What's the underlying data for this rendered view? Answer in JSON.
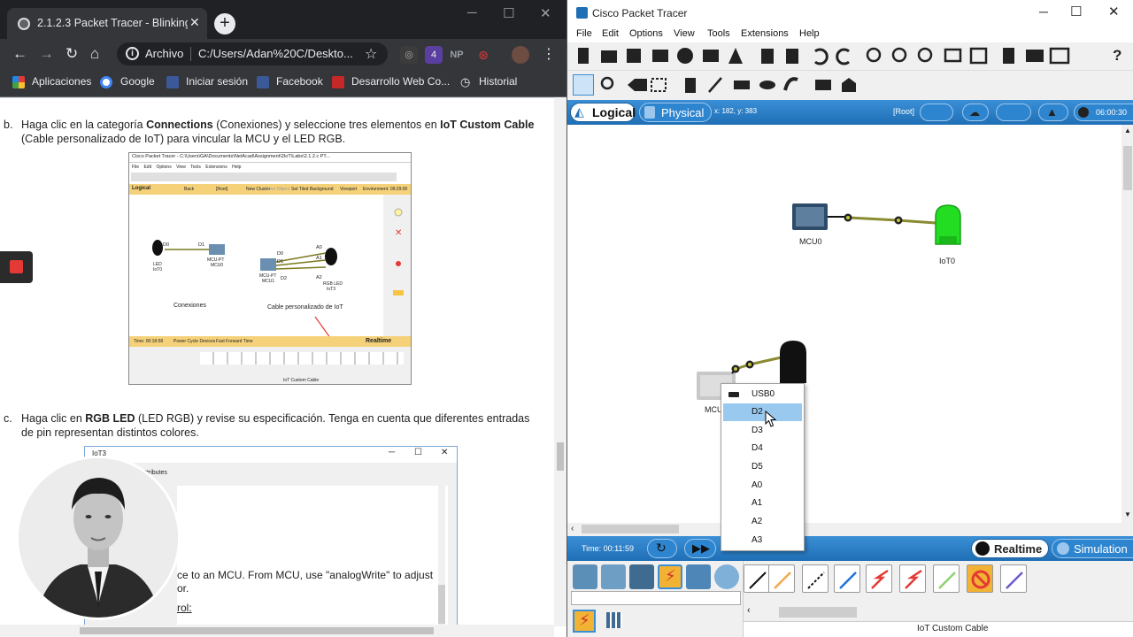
{
  "browser": {
    "tab_title": "2.1.2.3 Packet Tracer - Blinking an",
    "back": "←",
    "forward": "→",
    "reload": "↻",
    "home": "⌂",
    "address_prefix": "Archivo",
    "address_url": "C:/Users/Adan%20C/Deskto...",
    "ext_badge": "4",
    "ext_np": "NP",
    "bookmarks": [
      {
        "label": "Aplicaciones",
        "color": "#e37400"
      },
      {
        "label": "Google",
        "color": "#4285f4"
      },
      {
        "label": "Iniciar sesión",
        "color": "#3b5998"
      },
      {
        "label": "Facebook",
        "color": "#3b5998"
      },
      {
        "label": "Desarrollo Web Co...",
        "color": "#c62828"
      },
      {
        "label": "Historial",
        "color": "#9aa0a6"
      }
    ]
  },
  "doc": {
    "b_marker": "b.",
    "b_text_1": "Haga clic en la categoría ",
    "b_bold_1": "Connections",
    "b_text_2": " (Conexiones) y seleccione tres elementos en ",
    "b_bold_2": "IoT Custom Cable",
    "b_line2": "(Cable personalizado de IoT) para vincular la MCU y el LED RGB.",
    "c_marker": "c.",
    "c_text_1": "Haga clic en ",
    "c_bold": "RGB LED",
    "c_text_2": " (LED RGB) y revise su especificación. Tenga en cuenta que diferentes entradas",
    "c_line2": "de pin representan distintos colores.",
    "win2_title": "IoT3",
    "win2_tab": "ttributes",
    "win2_line1": "ce to an MCU. From MCU, use \"analogWrite\" to adjust",
    "win2_line2": "or.",
    "win2_line3": "rol:"
  },
  "thumb": {
    "title": "Cisco Packet Tracer - C:\\Users\\GA\\Documents\\NetAcad\\Assignment\\2IoT\\Labs\\2.1.2.c PT...",
    "menu": [
      "File",
      "Edit",
      "Options",
      "View",
      "Tools",
      "Extensions",
      "Help"
    ],
    "logical": "Logical",
    "back": "Back",
    "root": "[Root]",
    "new_cluster": "New Cluster",
    "move_object": "Move Object",
    "set_bg": "Set Tiled Background",
    "viewport": "Viewport",
    "environment": "Environment: 09:29:00",
    "led_label": "LED",
    "led_name": "IoT0",
    "mcu_label": "MCU-PT",
    "mcu_name": "MCU0",
    "mcu1_label": "MCU-PT",
    "mcu1_name": "MCU1",
    "rgb_label": "RGB LED",
    "rgb_name": "IoT3",
    "pins": [
      "D0",
      "D1",
      "D0",
      "D1",
      "D2",
      "A0",
      "A1",
      "A2"
    ],
    "conexiones": "Conexiones",
    "cable_label": "Cable personalizado de IoT",
    "time": "Time: 00:18:58",
    "power_cycle": "Power Cycle Devices",
    "fast_forward": "Fast Forward Time",
    "realtime": "Realtime",
    "footer": "IoT Custom Cable"
  },
  "pt": {
    "window_title": "Cisco Packet Tracer",
    "menu": [
      "File",
      "Edit",
      "Options",
      "View",
      "Tools",
      "Extensions",
      "Help"
    ],
    "help_icon": "?",
    "logical_label": "Logical",
    "physical_label": "Physical",
    "coords": "x: 182, y: 383",
    "root_label": "[Root]",
    "time_right": "06:00:30",
    "devices": [
      {
        "name": "MCU0"
      },
      {
        "name": "IoT0"
      },
      {
        "name": "MCU"
      }
    ],
    "context_menu": [
      "USB0",
      "D2",
      "D3",
      "D4",
      "D5",
      "A0",
      "A1",
      "A2",
      "A3"
    ],
    "context_selected": "D2",
    "time_label": "Time: 00:11:59",
    "realtime": "Realtime",
    "simulation": "Simulation",
    "footer_label": "IoT Custom Cable",
    "colors": {
      "accent": "#1f6fb5",
      "led_green": "#22dd22",
      "selected": "#99c9ef"
    }
  }
}
